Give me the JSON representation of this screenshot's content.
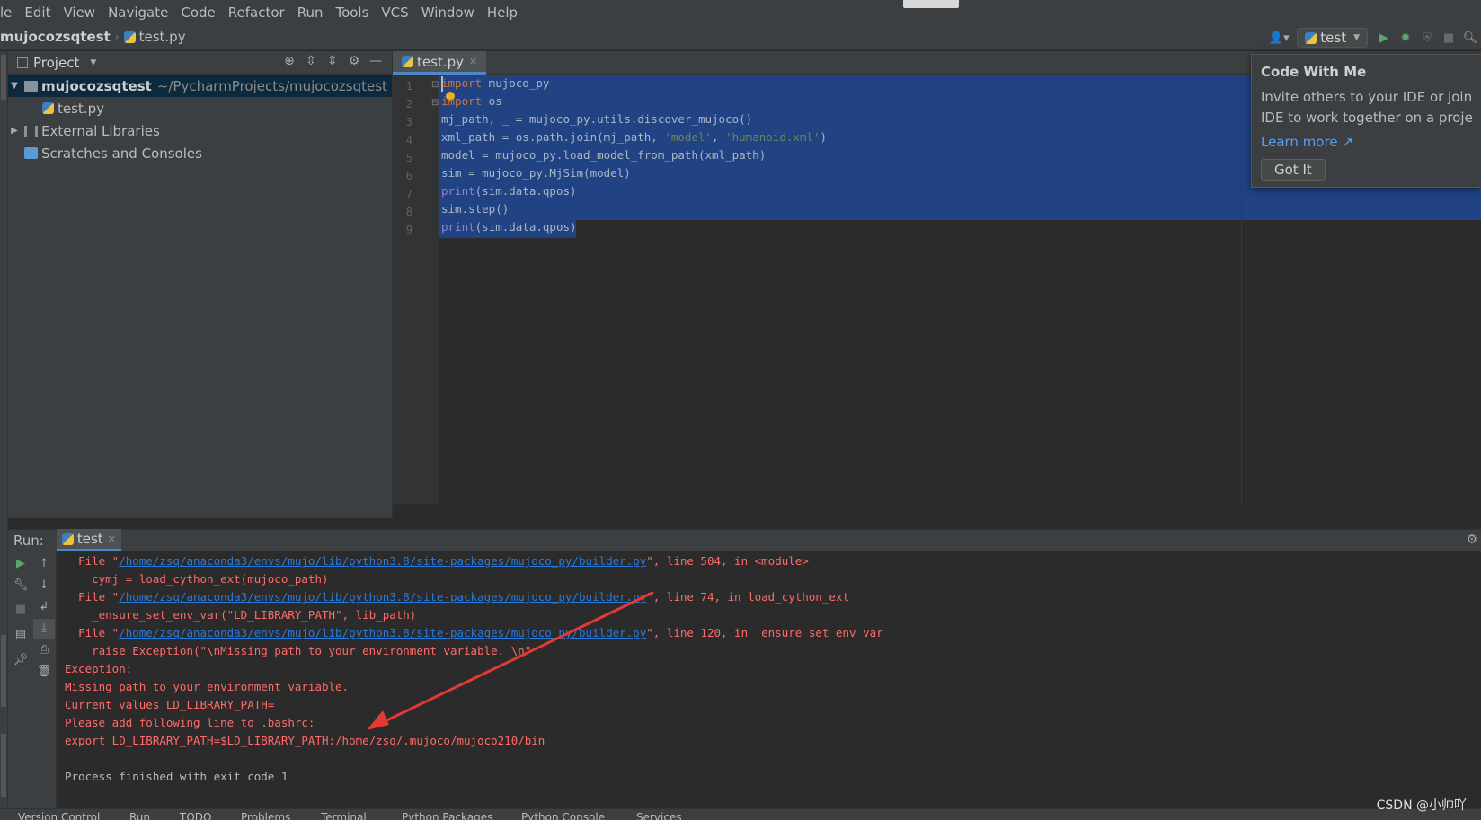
{
  "menu": [
    "le",
    "Edit",
    "View",
    "Navigate",
    "Code",
    "Refactor",
    "Run",
    "Tools",
    "VCS",
    "Window",
    "Help"
  ],
  "breadcrumb": {
    "project": "mujocozsqtest",
    "file": "test.py"
  },
  "run_config": {
    "name": "test"
  },
  "project_panel": {
    "title": "Project",
    "root": {
      "name": "mujocozsqtest",
      "path": "~/PycharmProjects/mujocozsqtest"
    },
    "items": [
      "test.py",
      "External Libraries",
      "Scratches and Consoles"
    ]
  },
  "editor": {
    "tab": "test.py",
    "line_numbers": [
      "1",
      "2",
      "3",
      "4",
      "5",
      "6",
      "7",
      "8",
      "9"
    ],
    "lines": [
      {
        "kw": "import",
        "rest": " mujoco_py"
      },
      {
        "kw": "import",
        "rest": " os"
      },
      {
        "a": "mj_path, _ = mujoco_py.utils.discover_mujoco()"
      },
      {
        "a": "xml_path = os.path.join(mj_path, ",
        "s1": "'model'",
        "b": ", ",
        "s2": "'humanoid.xml'",
        "c": ")"
      },
      {
        "a": "model = mujoco_py.load_model_from_path(xml_path)"
      },
      {
        "a": "sim = mujoco_py.MjSim(model)"
      },
      {
        "fn": "print",
        "rest": "(sim.data.qpos)"
      },
      {
        "a": "sim.step()"
      },
      {
        "fn": "print",
        "rest": "(sim.data.qpos)"
      }
    ]
  },
  "popup": {
    "title": "Code With Me",
    "body1": "Invite others to your IDE or join anothe",
    "body2": "IDE to work together on a project",
    "link": "Learn more ↗",
    "button": "Got It"
  },
  "run_panel": {
    "label": "Run:",
    "tab": "test",
    "console": [
      {
        "pre": "  File \"",
        "link": "/home/zsq/anaconda3/envs/mujo/lib/python3.8/site-packages/mujoco_py/builder.py",
        "post": "\", line 504, in <module>"
      },
      {
        "text": "    cymj = load_cython_ext(mujoco_path)"
      },
      {
        "pre": "  File \"",
        "link": "/home/zsq/anaconda3/envs/mujo/lib/python3.8/site-packages/mujoco_py/builder.py",
        "post": "\", line 74, in load_cython_ext"
      },
      {
        "text": "    _ensure_set_env_var(\"LD_LIBRARY_PATH\", lib_path)"
      },
      {
        "pre": "  File \"",
        "link": "/home/zsq/anaconda3/envs/mujo/lib/python3.8/site-packages/mujoco_py/builder.py",
        "post": "\", line 120, in _ensure_set_env_var"
      },
      {
        "text": "    raise Exception(\"\\nMissing path to your environment variable. \\n\""
      },
      {
        "text": "Exception:"
      },
      {
        "text": "Missing path to your environment variable."
      },
      {
        "text": "Current values LD_LIBRARY_PATH="
      },
      {
        "text": "Please add following line to .bashrc:"
      },
      {
        "text": "export LD_LIBRARY_PATH=$LD_LIBRARY_PATH:/home/zsq/.mujoco/mujoco210/bin"
      },
      {
        "text": ""
      },
      {
        "text": "Process finished with exit code 1",
        "plain": true
      }
    ]
  },
  "status_tabs": [
    "Version Control",
    "Run",
    "TODO",
    "Problems",
    "Terminal",
    "Python Packages",
    "Python Console",
    "Services"
  ],
  "watermark": "CSDN @小帅吖",
  "colors": {
    "selection": "#214283",
    "error_text": "#ff6b68",
    "link": "#287bde",
    "annotation_arrow": "#e53935"
  }
}
